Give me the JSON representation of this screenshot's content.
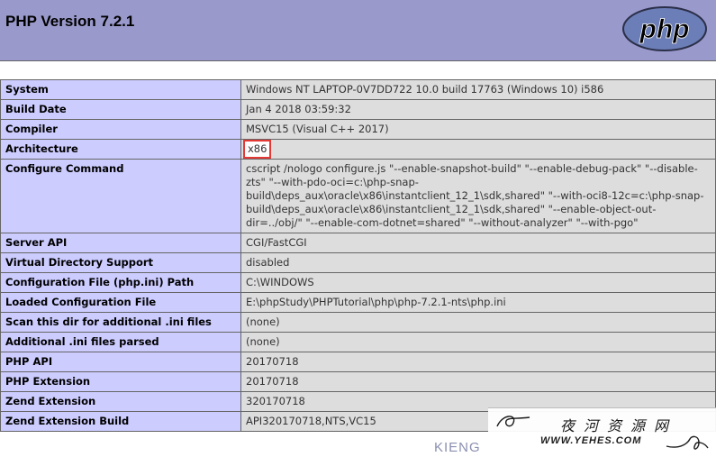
{
  "header": {
    "title": "PHP Version 7.2.1",
    "logo_text": "php"
  },
  "rows": [
    {
      "key": "System",
      "value": "Windows NT LAPTOP-0V7DD722 10.0 build 17763 (Windows 10) i586"
    },
    {
      "key": "Build Date",
      "value": "Jan 4 2018 03:59:32"
    },
    {
      "key": "Compiler",
      "value": "MSVC15 (Visual C++ 2017)"
    },
    {
      "key": "Architecture",
      "value": "x86"
    },
    {
      "key": "Configure Command",
      "value": "cscript /nologo configure.js \"--enable-snapshot-build\" \"--enable-debug-pack\" \"--disable-zts\" \"--with-pdo-oci=c:\\php-snap-build\\deps_aux\\oracle\\x86\\instantclient_12_1\\sdk,shared\" \"--with-oci8-12c=c:\\php-snap-build\\deps_aux\\oracle\\x86\\instantclient_12_1\\sdk,shared\" \"--enable-object-out-dir=../obj/\" \"--enable-com-dotnet=shared\" \"--without-analyzer\" \"--with-pgo\""
    },
    {
      "key": "Server API",
      "value": "CGI/FastCGI"
    },
    {
      "key": "Virtual Directory Support",
      "value": "disabled"
    },
    {
      "key": "Configuration File (php.ini) Path",
      "value": "C:\\WINDOWS"
    },
    {
      "key": "Loaded Configuration File",
      "value": "E:\\phpStudy\\PHPTutorial\\php\\php-7.2.1-nts\\php.ini"
    },
    {
      "key": "Scan this dir for additional .ini files",
      "value": "(none)"
    },
    {
      "key": "Additional .ini files parsed",
      "value": "(none)"
    },
    {
      "key": "PHP API",
      "value": "20170718"
    },
    {
      "key": "PHP Extension",
      "value": "20170718"
    },
    {
      "key": "Zend Extension",
      "value": "320170718"
    },
    {
      "key": "Zend Extension Build",
      "value": "API320170718,NTS,VC15"
    }
  ],
  "watermark": {
    "cn_text": "夜河资源网",
    "url_text": "WWW.YEHES.COM",
    "overlay_text": "KIENG"
  },
  "colors": {
    "header_bg": "#9999cc",
    "key_bg": "#ccccff",
    "value_bg": "#dddddd",
    "highlight_border": "#e53935"
  }
}
